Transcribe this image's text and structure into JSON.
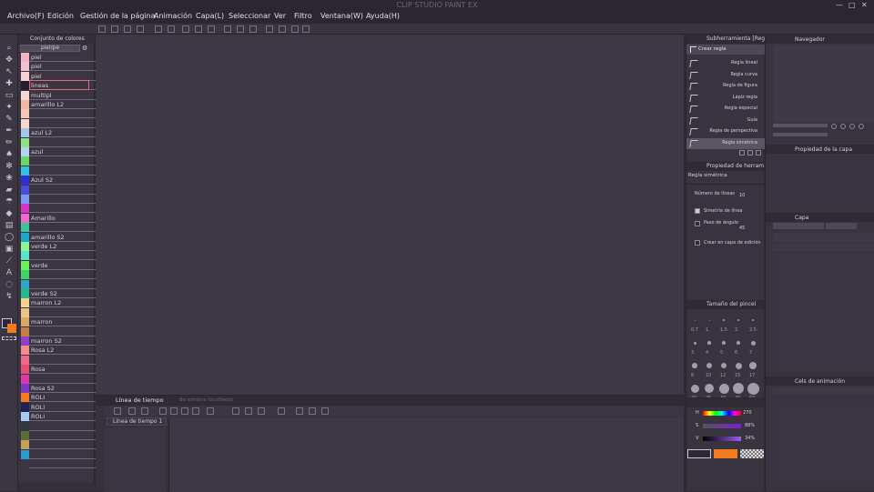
{
  "app_title": "CLIP STUDIO PAINT EX",
  "window_controls": [
    "—",
    "□",
    "✕"
  ],
  "menu": [
    "Archivo(F)",
    "Edición",
    "Gestión de la página",
    "Animación",
    "Capa(L)",
    "Seleccionar",
    "Ver",
    "Filtro",
    "Ventana(W)",
    "Ayuda(H)"
  ],
  "color_set": {
    "title": "Conjunto de colores",
    "set_name": "piel/pe",
    "swatches": [
      {
        "label": "piel",
        "color": "#f1b4c3"
      },
      {
        "label": "piel",
        "color": "#f4c1cf"
      },
      {
        "label": "piel",
        "color": "#f7cdd7"
      },
      {
        "label": "lineas",
        "color": "#2a1d2b"
      },
      {
        "label": "multipl",
        "color": "#f6d7d8"
      },
      {
        "label": "amarillo L2",
        "color": "#f3b8a2"
      },
      {
        "label": "",
        "color": "#f6c5b5"
      },
      {
        "label": "",
        "color": "#f8d9cc"
      },
      {
        "label": "azul L2",
        "color": "#a7c5e8"
      },
      {
        "label": "",
        "color": "#8ee27f"
      },
      {
        "label": "azul",
        "color": "#b3d4f4"
      },
      {
        "label": "",
        "color": "#6cd86a"
      },
      {
        "label": "",
        "color": "#33c2e0"
      },
      {
        "label": "Azul S2",
        "color": "#2d2fd4"
      },
      {
        "label": "",
        "color": "#4a4bd6"
      },
      {
        "label": "",
        "color": "#7a9af0"
      },
      {
        "label": "",
        "color": "#d335c5"
      },
      {
        "label": "Amarillo",
        "color": "#f06acb"
      },
      {
        "label": "",
        "color": "#3cc4a0"
      },
      {
        "label": "amarillo S2",
        "color": "#1fa5c9"
      },
      {
        "label": "verde L2",
        "color": "#8ef29a"
      },
      {
        "label": "",
        "color": "#5de3c5"
      },
      {
        "label": "verde",
        "color": "#6df05a"
      },
      {
        "label": "",
        "color": "#3ad66a"
      },
      {
        "label": "",
        "color": "#2fa5c9"
      },
      {
        "label": "verde S2",
        "color": "#28b88e"
      },
      {
        "label": "marron L2",
        "color": "#f6d38b"
      },
      {
        "label": "",
        "color": "#e6c68a"
      },
      {
        "label": "marron",
        "color": "#d9a866"
      },
      {
        "label": "",
        "color": "#c38044"
      },
      {
        "label": "marron S2",
        "color": "#8f3fce"
      },
      {
        "label": "Rosa L2",
        "color": "#f08f8a"
      },
      {
        "label": "",
        "color": "#ef6a86"
      },
      {
        "label": "Rosa",
        "color": "#e74e74"
      },
      {
        "label": "",
        "color": "#d93ba6"
      },
      {
        "label": "Rosa S2",
        "color": "#7b3ac4"
      },
      {
        "label": "ROLI",
        "color": "#f27a1f"
      },
      {
        "label": "ROLI",
        "color": "#1d2452"
      },
      {
        "label": "ROLI",
        "color": "#a9cbf3"
      },
      {
        "label": "",
        "color": "#2f3b3a"
      },
      {
        "label": "",
        "color": "#5f6b3a"
      },
      {
        "label": "",
        "color": "#c4a15a"
      },
      {
        "label": "",
        "color": "#2b9bd6"
      },
      {
        "label": "",
        "color": "#3b3641"
      }
    ]
  },
  "timeline": {
    "tab_label": "Línea de tiempo",
    "tab2_label": "de sombra (ocultado)",
    "timeline_name": "Línea de tiempo 1"
  },
  "sub_tool": {
    "title": "Subherramienta [Reg",
    "group": "Crear regla",
    "rulers": [
      "Regla lineal",
      "Regla curva",
      "Regla de figura",
      "Lápiz regla",
      "Regla especial",
      "Guía",
      "Regla de perspectiva",
      "Regla simétrica"
    ]
  },
  "tool_property": {
    "title": "Propiedad de herram",
    "tool_name": "Regla simétrica",
    "lines_label": "Número de líneas",
    "lines_value": "10",
    "snap_label": "Simetría de línea",
    "angle_label": "Paso de ángulo",
    "angle_value": "45",
    "edit_layer_label": "Crear en capa de edición"
  },
  "brush_size": {
    "title": "Tamaño del pincel",
    "sizes": [
      "0.7",
      "1",
      "1.5",
      "2",
      "2.5",
      "3",
      "4",
      "5",
      "6",
      "7",
      "8",
      "10",
      "12",
      "15",
      "17",
      "20",
      "25",
      "30",
      "40",
      "50"
    ]
  },
  "color_sliders": {
    "h_label": "H",
    "h_value": "270",
    "s_label": "S",
    "s_value": "88%",
    "v_label": "V",
    "v_value": "34%",
    "main_color": "#2d2838",
    "sub_color": "#f27a1f"
  },
  "navigator": {
    "title": "Navegador"
  },
  "layer_property": {
    "title": "Propiedad de la capa"
  },
  "layer": {
    "title": "Capa"
  },
  "animation_cels": {
    "title": "Cels de animación"
  }
}
